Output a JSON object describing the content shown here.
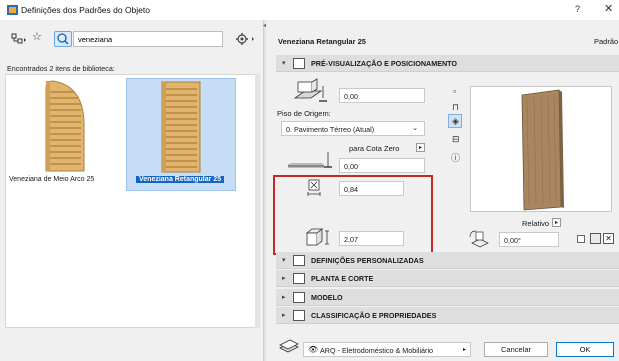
{
  "window": {
    "title": "Definições dos Padrões do Objeto",
    "help_label": "?",
    "close_label": "✕"
  },
  "left_panel": {
    "search": {
      "value": "veneziana"
    },
    "found_text": "Encontrados 2 itens de biblioteca:",
    "items": [
      {
        "label": "Veneziana de Meio Arco 25",
        "selected": false
      },
      {
        "label": "Veneziana Retangular 25",
        "selected": true
      }
    ]
  },
  "right_panel": {
    "object_name": "Veneziana Retangular 25",
    "padrao_label": "Padrão",
    "sections": {
      "preview_positioning": "PRÉ-VISUALIZAÇÃO E POSICIONAMENTO",
      "custom_settings": "DEFINIÇÕES PERSONALIZADAS",
      "plan_section": "PLANTA E CORTE",
      "model": "MODELO",
      "classification": "CLASSIFICAÇÃO E PROPRIEDADES"
    },
    "fields": {
      "elevation": "0,00",
      "origin_floor_label": "Piso de Origem:",
      "origin_floor_value": "0. Pavimento Térreo (Atual)",
      "reference_label": "para Cota Zero",
      "reference_value": "0,00",
      "width": "0,84",
      "height": "2,07",
      "relativo_label": "Relativo",
      "angle": "0,00°"
    }
  },
  "footer": {
    "layer_value": "ARQ - Eletrodoméstico & Mobiliário",
    "cancel_label": "Cancelar",
    "ok_label": "OK"
  },
  "colors": {
    "selection_blue": "#1565c0",
    "highlight_red": "#c62828",
    "thumbnail_wood": "#e2b56e"
  }
}
